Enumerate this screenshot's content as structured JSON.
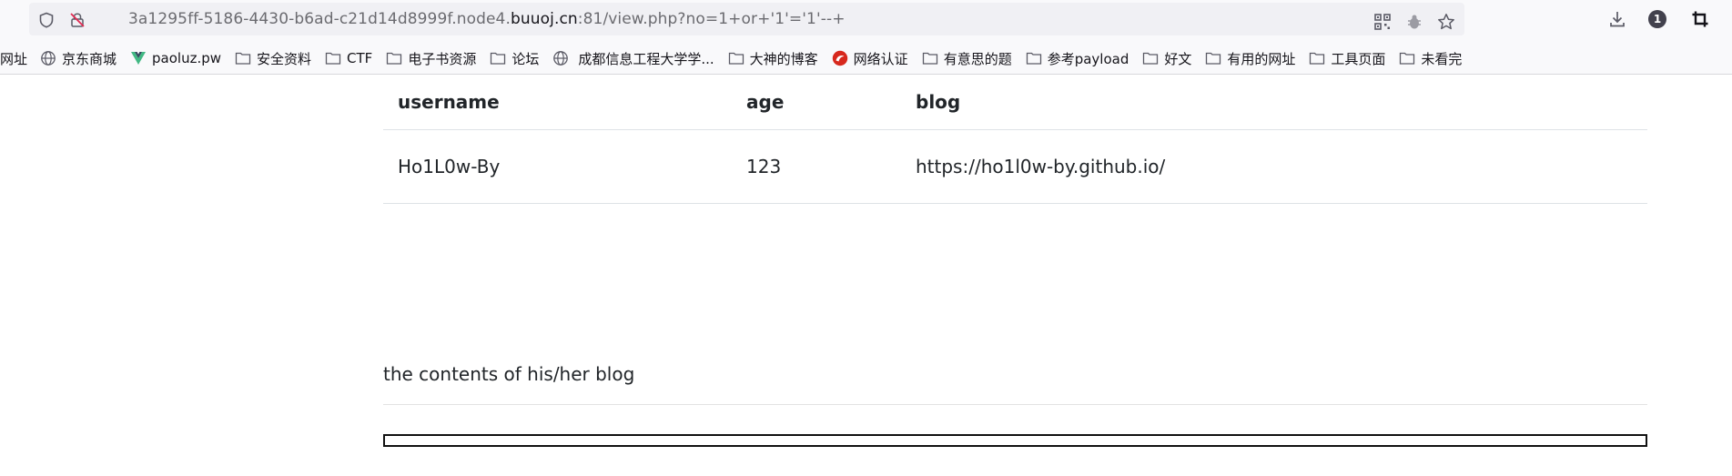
{
  "browser": {
    "url": {
      "prefix": "3a1295ff-5186-4430-b6ad-c21d14d8999f.node4.",
      "host": "buuoj.cn",
      "suffix": ":81/view.php?no=1+or+'1'='1'--+"
    },
    "download_count": "1",
    "bookmarks": [
      {
        "label": "网址",
        "icon": "none"
      },
      {
        "label": "京东商城",
        "icon": "globe-icon"
      },
      {
        "label": "paoluz.pw",
        "icon": "vue-logo-icon"
      },
      {
        "label": "安全资料",
        "icon": "folder-icon"
      },
      {
        "label": "CTF",
        "icon": "folder-icon"
      },
      {
        "label": "电子书资源",
        "icon": "folder-icon"
      },
      {
        "label": "论坛",
        "icon": "folder-icon"
      },
      {
        "label": "成都信息工程大学学...",
        "icon": "globe-icon"
      },
      {
        "label": "大神的博客",
        "icon": "folder-icon"
      },
      {
        "label": "网络认证",
        "icon": "red-logo-icon"
      },
      {
        "label": "有意思的题",
        "icon": "folder-icon"
      },
      {
        "label": "参考payload",
        "icon": "folder-icon"
      },
      {
        "label": "好文",
        "icon": "folder-icon"
      },
      {
        "label": "有用的网址",
        "icon": "folder-icon"
      },
      {
        "label": "工具页面",
        "icon": "folder-icon"
      },
      {
        "label": "未看完",
        "icon": "folder-icon"
      }
    ]
  },
  "table": {
    "headers": [
      "username",
      "age",
      "blog"
    ],
    "rows": [
      [
        "Ho1L0w-By",
        "123",
        "https://ho1l0w-by.github.io/"
      ]
    ]
  },
  "blog_section": {
    "label": "the contents of his/her blog"
  }
}
